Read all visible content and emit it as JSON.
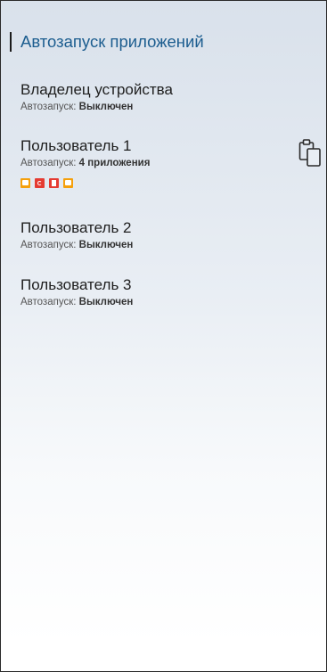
{
  "header": {
    "title": "Автозапуск приложений"
  },
  "users": [
    {
      "name": "Владелец устройства",
      "autostart_label": "Автозапуск:",
      "autostart_value": "Выключен"
    },
    {
      "name": "Пользователь 1",
      "autostart_label": "Автозапуск:",
      "autostart_value": "4 приложения",
      "apps": [
        {
          "icon": "notes-app-icon",
          "color": "#f5a00c"
        },
        {
          "icon": "sync-app-icon",
          "color": "#e53b32"
        },
        {
          "icon": "document-app-icon",
          "color": "#e53b32"
        },
        {
          "icon": "notes-app-icon",
          "color": "#f5a00c"
        }
      ]
    },
    {
      "name": "Пользователь 2",
      "autostart_label": "Автозапуск:",
      "autostart_value": "Выключен"
    },
    {
      "name": "Пользователь 3",
      "autostart_label": "Автозапуск:",
      "autostart_value": "Выключен"
    }
  ],
  "actions": {
    "copy_icon": "clipboard-icon"
  }
}
